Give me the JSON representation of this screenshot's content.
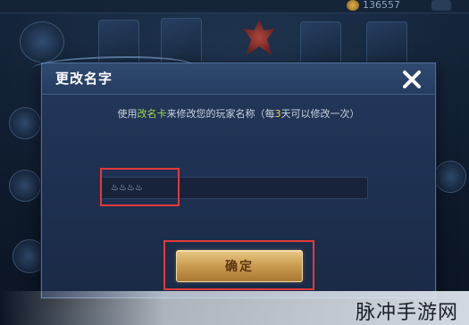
{
  "background": {
    "coin_amount": "136557"
  },
  "dialog": {
    "title": "更改名字",
    "info": {
      "prefix": "使用",
      "item": "改名卡",
      "middle": "来修改您的玩家名称（每",
      "days": "3",
      "suffix": "天可以修改一次）"
    },
    "name_input": {
      "value": "♨♨♨♨"
    },
    "confirm_label": "确定",
    "close_icon": "close-x-icon"
  },
  "watermark": {
    "text": "脉冲手游网"
  },
  "colors": {
    "highlight_red": "#e23a3a",
    "item_green": "#9ed84a",
    "days_yellow": "#ffd23c",
    "button_gold": "#c99b50"
  }
}
